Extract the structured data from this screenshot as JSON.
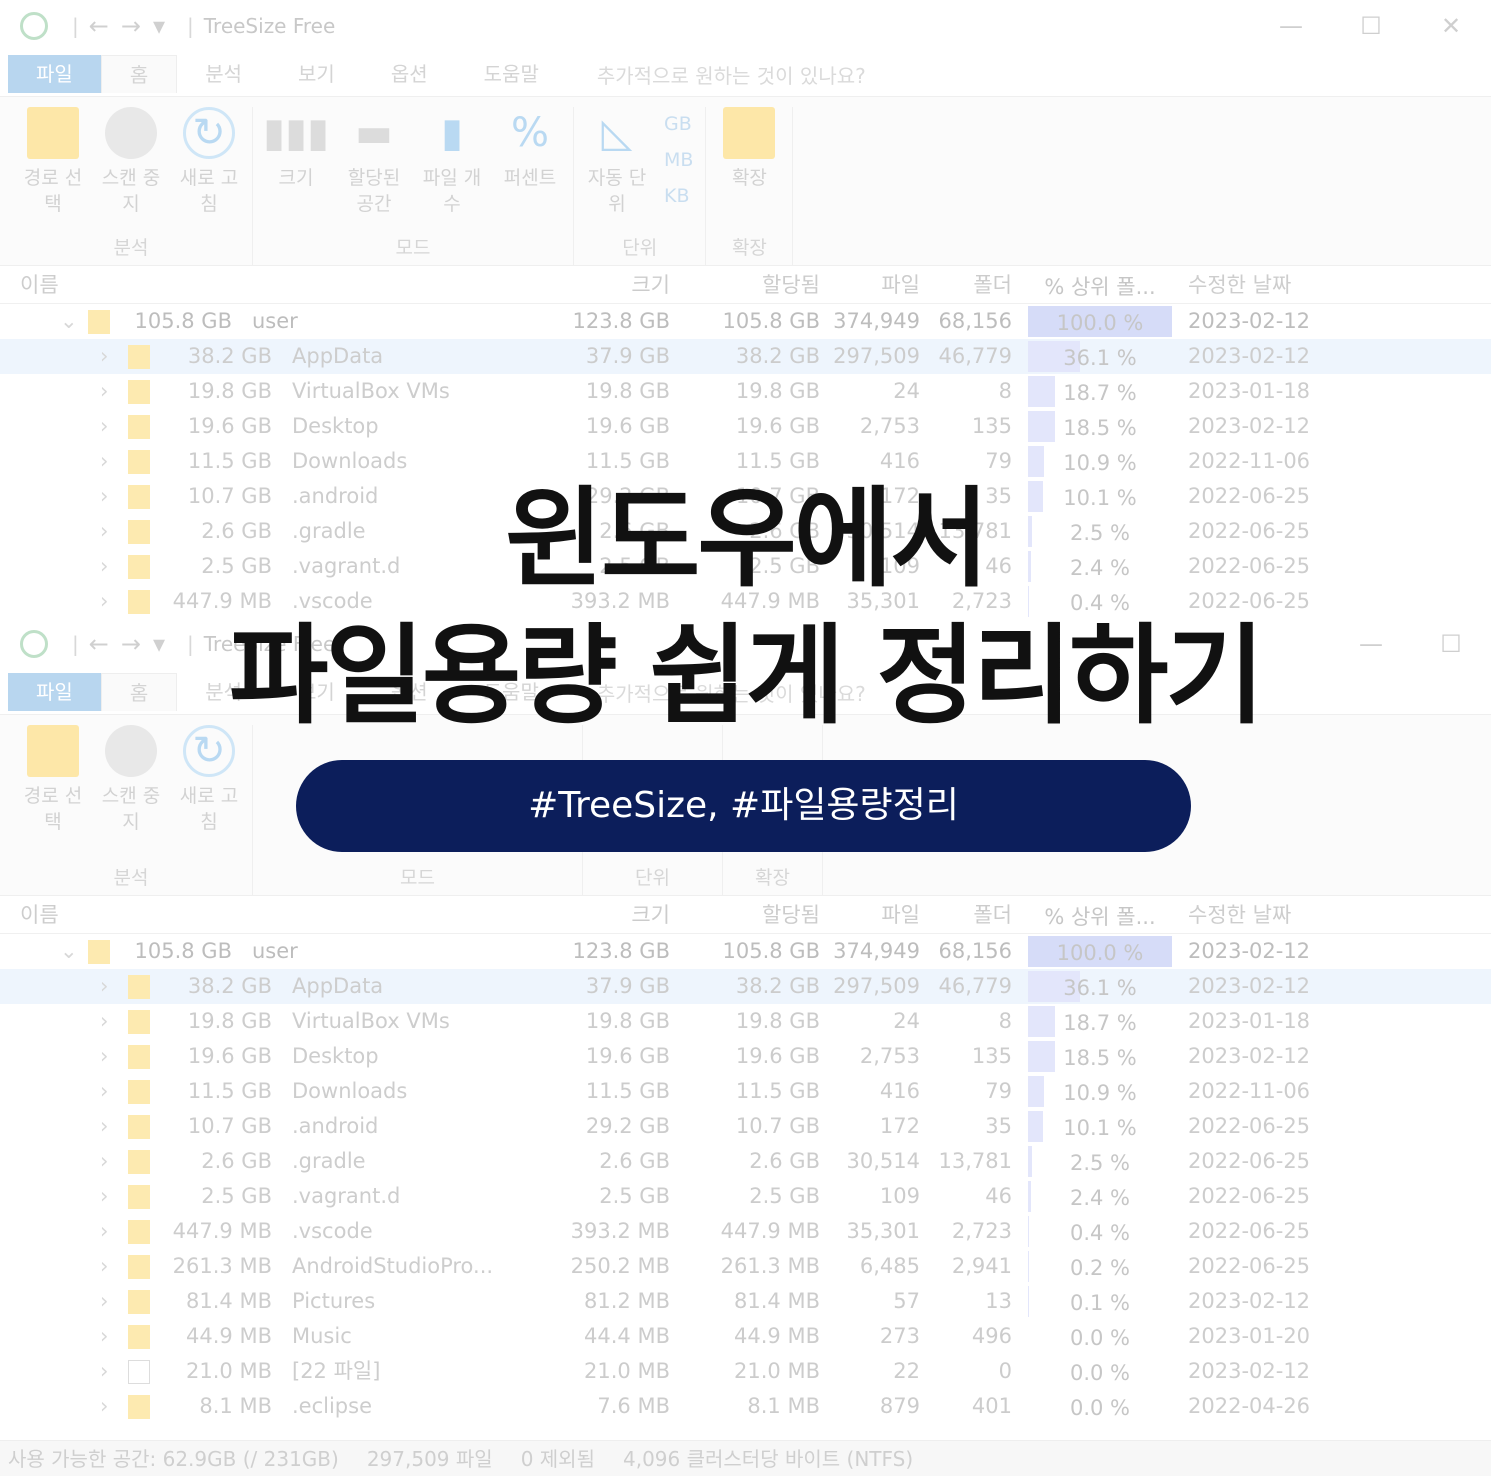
{
  "window": {
    "title": "TreeSize Free",
    "tabs": [
      "파일",
      "홈",
      "분석",
      "보기",
      "옵션",
      "도움말"
    ],
    "hint": "추가적으로 원하는 것이 있나요?"
  },
  "ribbon": {
    "analysis": {
      "label": "분석",
      "items": [
        "경로 선택",
        "스캔 중지",
        "새로 고침"
      ]
    },
    "mode": {
      "label": "모드",
      "items": [
        "크기",
        "할당된 공간",
        "파일 개수",
        "퍼센트"
      ]
    },
    "unit": {
      "label": "단위",
      "auto": "자동 단위",
      "units": [
        "GB",
        "MB",
        "KB"
      ]
    },
    "expand": {
      "label": "확장",
      "item": "확장"
    }
  },
  "columns": [
    "이름",
    "크기",
    "할당됨",
    "파일",
    "폴더",
    "% 상위 폴...",
    "수정한 날짜"
  ],
  "rows": [
    {
      "alloc_label": "105.8 GB",
      "name": "user",
      "size": "123.8 GB",
      "alloc": "105.8 GB",
      "files": "374,949",
      "folders": "68,156",
      "pct": "100.0 %",
      "pct_value": 100.0,
      "date": "2023-02-12",
      "expanded": true
    },
    {
      "alloc_label": "38.2 GB",
      "name": "AppData",
      "size": "37.9 GB",
      "alloc": "38.2 GB",
      "files": "297,509",
      "folders": "46,779",
      "pct": "36.1 %",
      "pct_value": 36.1,
      "date": "2023-02-12",
      "selected": true
    },
    {
      "alloc_label": "19.8 GB",
      "name": "VirtualBox VMs",
      "size": "19.8 GB",
      "alloc": "19.8 GB",
      "files": "24",
      "folders": "8",
      "pct": "18.7 %",
      "pct_value": 18.7,
      "date": "2023-01-18"
    },
    {
      "alloc_label": "19.6 GB",
      "name": "Desktop",
      "size": "19.6 GB",
      "alloc": "19.6 GB",
      "files": "2,753",
      "folders": "135",
      "pct": "18.5 %",
      "pct_value": 18.5,
      "date": "2023-02-12"
    },
    {
      "alloc_label": "11.5 GB",
      "name": "Downloads",
      "size": "11.5 GB",
      "alloc": "11.5 GB",
      "files": "416",
      "folders": "79",
      "pct": "10.9 %",
      "pct_value": 10.9,
      "date": "2022-11-06"
    },
    {
      "alloc_label": "10.7 GB",
      "name": ".android",
      "size": "29.2 GB",
      "alloc": "10.7 GB",
      "files": "172",
      "folders": "35",
      "pct": "10.1 %",
      "pct_value": 10.1,
      "date": "2022-06-25"
    },
    {
      "alloc_label": "2.6 GB",
      "name": ".gradle",
      "size": "2.6 GB",
      "alloc": "2.6 GB",
      "files": "30,514",
      "folders": "13,781",
      "pct": "2.5 %",
      "pct_value": 2.5,
      "date": "2022-06-25"
    },
    {
      "alloc_label": "2.5 GB",
      "name": ".vagrant.d",
      "size": "2.5 GB",
      "alloc": "2.5 GB",
      "files": "109",
      "folders": "46",
      "pct": "2.4 %",
      "pct_value": 2.4,
      "date": "2022-06-25"
    },
    {
      "alloc_label": "447.9 MB",
      "name": ".vscode",
      "size": "393.2 MB",
      "alloc": "447.9 MB",
      "files": "35,301",
      "folders": "2,723",
      "pct": "0.4 %",
      "pct_value": 0.4,
      "date": "2022-06-25"
    },
    {
      "alloc_label": "261.3 MB",
      "name": "AndroidStudioPro...",
      "size": "250.2 MB",
      "alloc": "261.3 MB",
      "files": "6,485",
      "folders": "2,941",
      "pct": "0.2 %",
      "pct_value": 0.2,
      "date": "2022-06-25"
    },
    {
      "alloc_label": "81.4 MB",
      "name": "Pictures",
      "size": "81.2 MB",
      "alloc": "81.4 MB",
      "files": "57",
      "folders": "13",
      "pct": "0.1 %",
      "pct_value": 0.1,
      "date": "2023-02-12"
    },
    {
      "alloc_label": "44.9 MB",
      "name": "Music",
      "size": "44.4 MB",
      "alloc": "44.9 MB",
      "files": "273",
      "folders": "496",
      "pct": "0.0 %",
      "pct_value": 0.0,
      "date": "2023-01-20"
    },
    {
      "alloc_label": "21.0 MB",
      "name": "[22 파일]",
      "size": "21.0 MB",
      "alloc": "21.0 MB",
      "files": "22",
      "folders": "0",
      "pct": "0.0 %",
      "pct_value": 0.0,
      "date": "2023-02-12",
      "is_files": true
    },
    {
      "alloc_label": "8.1 MB",
      "name": ".eclipse",
      "size": "7.6 MB",
      "alloc": "8.1 MB",
      "files": "879",
      "folders": "401",
      "pct": "0.0 %",
      "pct_value": 0.0,
      "date": "2022-04-26"
    }
  ],
  "status": {
    "free": "사용 가능한 공간: 62.9GB  (/ 231GB)",
    "files": "297,509 파일",
    "excluded": "0 제외됨",
    "cluster": "4,096 클러스터당 바이트 (NTFS)"
  },
  "overlay": {
    "line1": "윈도우에서",
    "line2": "파일용량 쉽게 정리하기",
    "tags": "#TreeSize, #파일용량정리"
  },
  "colors": {
    "pill": "#0c1e5b",
    "headline": "#111111",
    "pct_fill": "#e3e6fb",
    "folder": "#fdeab0"
  }
}
